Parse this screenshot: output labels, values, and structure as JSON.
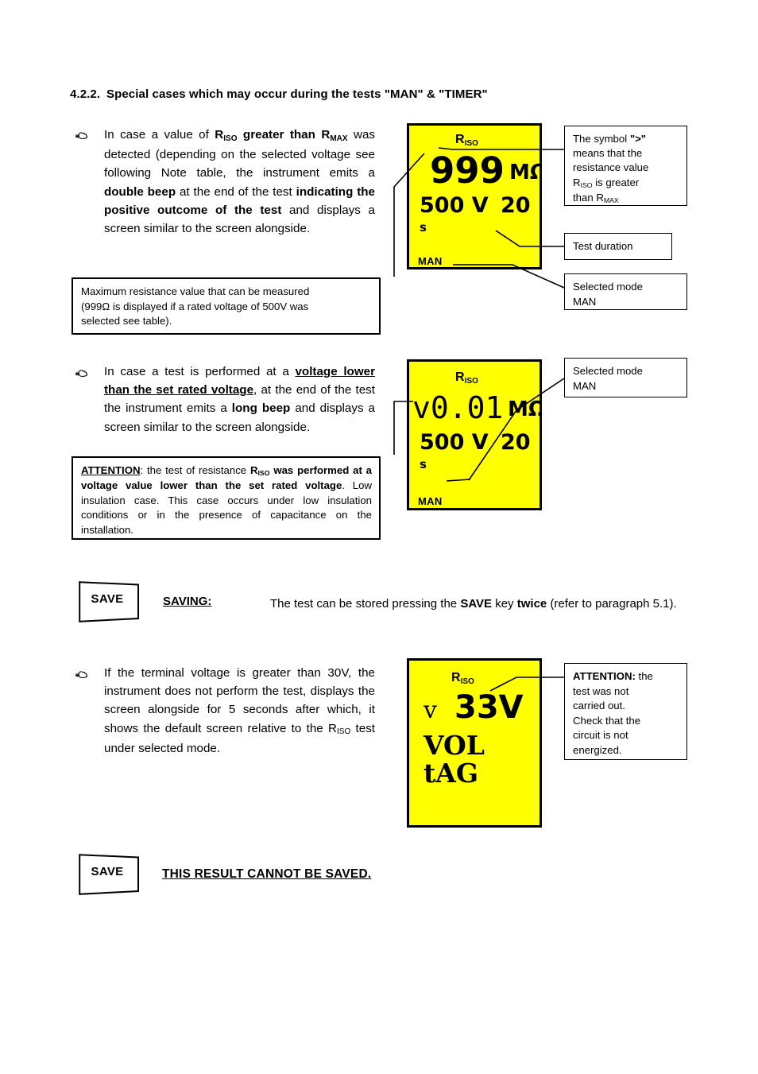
{
  "document": {
    "section_number": "4.2.2.",
    "section_title": "Special cases which may occur during the tests \"MAN\" & \"TIMER\""
  },
  "item1": {
    "text_parts": {
      "p1": "In case a value of ",
      "riso": "R",
      "riso_sub": "ISO",
      "p2": " greater than ",
      "rmax": "R",
      "rmax_sub": "MAX",
      "p3": " was detected (depending on the selected voltage see following Note table, the instrument emits a ",
      "p4": "double beep",
      "p5": " at the end of the test ",
      "p6": "indicating the positive outcome of the test",
      "p7": " and displays a screen similar to the screen alongside."
    },
    "note_box": {
      "line1": "Maximum resistance value that can be measured",
      "line2": "(999Ω is displayed if a rated voltage of 500V was",
      "line3": "selected see table)."
    },
    "lcd": {
      "label": "R",
      "label_sub": "ISO",
      "value": "999",
      "unit": "MΩ",
      "voltage": "500 V",
      "duration": "20",
      "duration_unit": "s",
      "mode": "MAN"
    },
    "callouts": {
      "symbol_note": "The symbol \">\" means that the resistance value R₀ is greater than Rₘ",
      "symbol_note_l1": "The symbol ",
      "symbol_note_gt": "\">\"",
      "symbol_note_l2": "means that the",
      "symbol_note_l3": "resistance value",
      "symbol_note_l4a": "R",
      "symbol_note_l4sub": "ISO",
      "symbol_note_l4b": " is greater",
      "symbol_note_l5a": "than R",
      "symbol_note_l5sub": "MAX",
      "test_duration": "Test duration",
      "selected_mode_l1": "Selected mode",
      "selected_mode_l2": "MAN"
    }
  },
  "item2": {
    "text_parts": {
      "p1": "In case a test is performed at a ",
      "p2": "voltage lower than the set rated voltage",
      "p3": ", at the end of the test the instrument emits a ",
      "p4": "long beep",
      "p5": " and displays a screen similar to the screen alongside."
    },
    "attention_box": {
      "attention": "ATTENTION",
      "p1": ": the test of resistance ",
      "riso": "R",
      "riso_sub": "ISO",
      "p2": " was performed at a voltage value lower than the set rated voltage",
      "p3": ". Low insulation case. This case occurs under low insulation conditions or in the presence of capacitance on the installation."
    },
    "lcd": {
      "label": "R",
      "label_sub": "ISO",
      "prefix": "v",
      "value": "0.01",
      "unit": "MΩ",
      "voltage": "500 V",
      "duration": "20",
      "duration_unit": "s",
      "mode": "MAN"
    },
    "callouts": {
      "selected_mode_l1": "Selected mode",
      "selected_mode_l2": "MAN"
    }
  },
  "saving": {
    "key_label": "SAVE",
    "label": "SAVING",
    "colon": ":",
    "text_p1": "The test can be stored pressing the ",
    "text_save": "SAVE",
    "text_p2": " key ",
    "text_twice": "twice",
    "text_p3": " (refer to paragraph 5.1)."
  },
  "item3": {
    "text_parts": {
      "p1": "If the terminal voltage is greater than 30V, the instrument does not perform the test, displays the screen alongside for 5 seconds after which, it shows the default screen relative to the ",
      "riso": "R",
      "riso_sub": "ISO",
      "p2": " test under selected mode."
    },
    "lcd": {
      "label": "R",
      "label_sub": "ISO",
      "prefix": "v",
      "value": "33V",
      "line2": "VOL",
      "line3": "tAG"
    },
    "callouts": {
      "attention": "ATTENTION:",
      "l1": " the",
      "l2": "test was not",
      "l3": "carried out.",
      "l4": "Check that the",
      "l5": "circuit is not",
      "l6": "energized."
    }
  },
  "no_save": {
    "key_label": "SAVE",
    "text": "THIS RESULT CANNOT BE SAVED."
  },
  "colors": {
    "lcd_background": "#ffff00",
    "lcd_text": "#000000",
    "page_background": "#ffffff",
    "border": "#000000"
  }
}
